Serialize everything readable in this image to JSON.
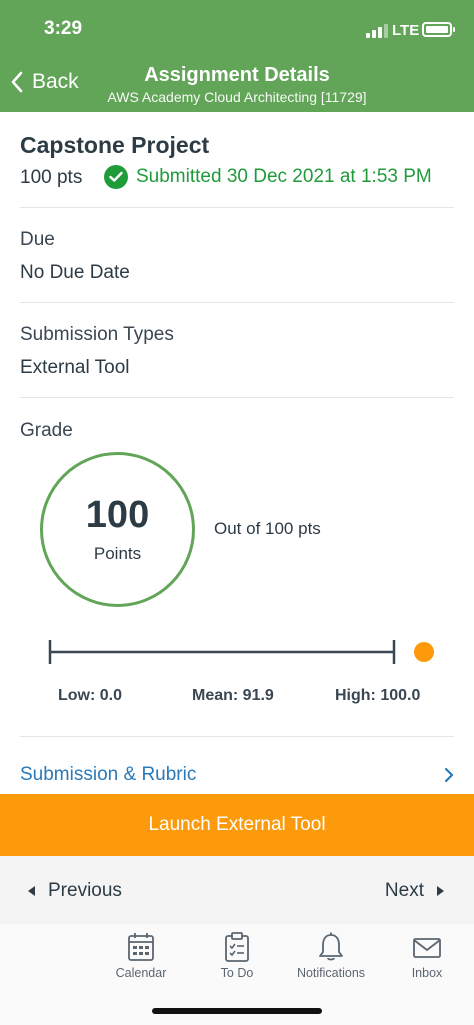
{
  "status_bar": {
    "time": "3:29",
    "network": "LTE"
  },
  "nav": {
    "back_label": "Back",
    "title": "Assignment Details",
    "subtitle": "AWS Academy Cloud Architecting [11729]"
  },
  "assignment": {
    "title": "Capstone Project",
    "points": "100 pts",
    "submitted": "Submitted 30 Dec 2021 at 1:53 PM"
  },
  "sections": {
    "due_label": "Due",
    "due_value": "No Due Date",
    "submission_types_label": "Submission Types",
    "submission_types_value": "External Tool",
    "grade_label": "Grade"
  },
  "grade": {
    "score": "100",
    "unit": "Points",
    "out_of": "Out of 100 pts",
    "low": "Low: 0.0",
    "mean": "Mean: 91.9",
    "high": "High: 100.0",
    "low_value": 0.0,
    "mean_value": 91.9,
    "high_value": 100.0,
    "score_value": 100,
    "max_value": 100
  },
  "links": {
    "submission_rubric": "Submission & Rubric"
  },
  "actions": {
    "launch": "Launch External Tool",
    "previous": "Previous",
    "next": "Next"
  },
  "tabs": [
    {
      "label": "Calendar",
      "icon": "calendar-icon"
    },
    {
      "label": "To Do",
      "icon": "todo-icon"
    },
    {
      "label": "Notifications",
      "icon": "bell-icon"
    },
    {
      "label": "Inbox",
      "icon": "inbox-icon"
    }
  ],
  "colors": {
    "header": "#62a558",
    "success": "#1f9b3a",
    "accent_orange": "#fc9a0b",
    "link": "#2a7ab8"
  }
}
